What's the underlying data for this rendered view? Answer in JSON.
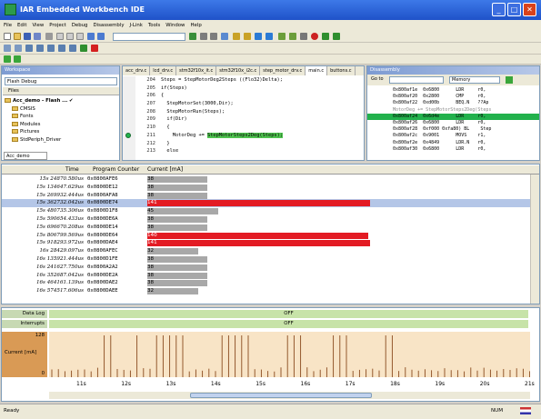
{
  "window": {
    "title": "IAR Embedded Workbench IDE",
    "min": "_",
    "max": "□",
    "close": "✕"
  },
  "menu": [
    "File",
    "Edit",
    "View",
    "Project",
    "Debug",
    "Disassembly",
    "J-Link",
    "Tools",
    "Window",
    "Help"
  ],
  "workspace": {
    "title": "Workspace",
    "config": "Flash Debug",
    "files_header": "Files",
    "tree": [
      "Acc_demo - Flash ...",
      "CMSIS",
      "Fonts",
      "Modules",
      "Pictures",
      "StdPeriph_Driver"
    ],
    "tab": "Acc_demo"
  },
  "editor": {
    "tabs": [
      "acc_drv.c",
      "lcd_drv.c",
      "stm32f10x_it.c",
      "stm32f10x_i2c.c",
      "step_motor_drv.c",
      "main.c",
      "buttons.c"
    ],
    "active_tab": 5,
    "lines": [
      {
        "n": "204",
        "text": "Steps = StepMotorDeg2Steps ((Flo32)Delta);"
      },
      {
        "n": "205",
        "text": "if(Steps)"
      },
      {
        "n": "206",
        "text": "{"
      },
      {
        "n": "207",
        "text": "  StepMotorSet(3000,Dir);"
      },
      {
        "n": "208",
        "text": "  StepMotorRun(Steps);"
      },
      {
        "n": "209",
        "text": "  if(Dir)"
      },
      {
        "n": "210",
        "text": "  {"
      },
      {
        "n": "211",
        "text": "    MotorDeg += ",
        "hl": "StepMotorSteps2Deg(Steps);"
      },
      {
        "n": "212",
        "text": "  }"
      },
      {
        "n": "213",
        "text": "  else"
      }
    ]
  },
  "disassembly": {
    "title": "Disassembly",
    "goto_label": "Go to",
    "memory": "Memory",
    "lines": [
      {
        "text": "0x800af1e  0x6800      LDR     r0,",
        "style": ""
      },
      {
        "text": "0x800af20  0x2800      CMP     r0,",
        "style": ""
      },
      {
        "text": "0x800af22  0xd00b      BEQ.N   ??Ap",
        "style": ""
      },
      {
        "text": "MotorDeg += StepMotorSteps2Deg(Steps",
        "style": "c"
      },
      {
        "text": "0x800af24  0x6d4e      LDR     r0,",
        "style": "g"
      },
      {
        "text": "0x800af26  0x6800      LDR     r0,",
        "style": ""
      },
      {
        "text": "0x800af28  0xf000 0xfa80) BL    Step",
        "style": ""
      },
      {
        "text": "0x800af2c  0x9001      MOVS    r1,",
        "style": ""
      },
      {
        "text": "0x800af2e  0x4849      LDR.N   r0,",
        "style": ""
      },
      {
        "text": "0x800af30  0x6800      LDR     r0,",
        "style": ""
      }
    ]
  },
  "trace": {
    "headers": {
      "time": "Time",
      "pc": "Program Counter",
      "cur": "Current [mA]"
    },
    "rows": [
      {
        "t": "15s  24870.580us",
        "pc": "0x0800AFE6",
        "cur": "38",
        "v": 38,
        "red": false,
        "sel": false
      },
      {
        "t": "15s  134647.629us",
        "pc": "0x0800DE12",
        "cur": "38",
        "v": 38,
        "red": false,
        "sel": false
      },
      {
        "t": "15s  269932.444us",
        "pc": "0x0800AFA8",
        "cur": "38",
        "v": 38,
        "red": false,
        "sel": false
      },
      {
        "t": "15s  362732.042us",
        "pc": "0x0800DE74",
        "cur": "141",
        "v": 141,
        "red": true,
        "sel": true
      },
      {
        "t": "15s  480735.306us",
        "pc": "0x0800D1F8",
        "cur": "45",
        "v": 45,
        "red": false,
        "sel": false
      },
      {
        "t": "15s  590654.433us",
        "pc": "0x0800DE6A",
        "cur": "38",
        "v": 38,
        "red": false,
        "sel": false
      },
      {
        "t": "15s  696670.208us",
        "pc": "0x0800DE14",
        "cur": "38",
        "v": 38,
        "red": false,
        "sel": false
      },
      {
        "t": "15s  806799.569us",
        "pc": "0x0800DE64",
        "cur": "140",
        "v": 140,
        "red": true,
        "sel": false
      },
      {
        "t": "15s  918293.972us",
        "pc": "0x0800DAE4",
        "cur": "141",
        "v": 141,
        "red": true,
        "sel": false
      },
      {
        "t": "16s  28429.097us",
        "pc": "0x0800AFEC",
        "cur": "32",
        "v": 32,
        "red": false,
        "sel": false
      },
      {
        "t": "16s  135921.444us",
        "pc": "0x0800D1FE",
        "cur": "38",
        "v": 38,
        "red": false,
        "sel": false
      },
      {
        "t": "16s  241627.750us",
        "pc": "0x0800A2A2",
        "cur": "38",
        "v": 38,
        "red": false,
        "sel": false
      },
      {
        "t": "16s  352687.042us",
        "pc": "0x0800DE2A",
        "cur": "38",
        "v": 38,
        "red": false,
        "sel": false
      },
      {
        "t": "16s  464161.139us",
        "pc": "0x0800DAE2",
        "cur": "38",
        "v": 38,
        "red": false,
        "sel": false
      },
      {
        "t": "16s  574517.606us",
        "pc": "0x0800DAEE",
        "cur": "32",
        "v": 32,
        "red": false,
        "sel": false
      }
    ]
  },
  "timeline": {
    "lane1_label": "Data Log",
    "lane1_value": "OFF",
    "lane2_label": "Interrupts",
    "lane2_value": "OFF",
    "graph_label": "Current [mA]",
    "graph_max": "128",
    "graph_min": "0",
    "ticks": [
      "11s",
      "12s",
      "13s",
      "14s",
      "15s",
      "16s",
      "17s",
      "18s",
      "19s",
      "20s",
      "21s"
    ]
  },
  "status": {
    "left": "Ready",
    "num": "NUM"
  },
  "colors": {
    "red": "#e31b23",
    "gray": "#a8a8a8",
    "green": "#22b14c",
    "spike": "#8a4a1e"
  }
}
